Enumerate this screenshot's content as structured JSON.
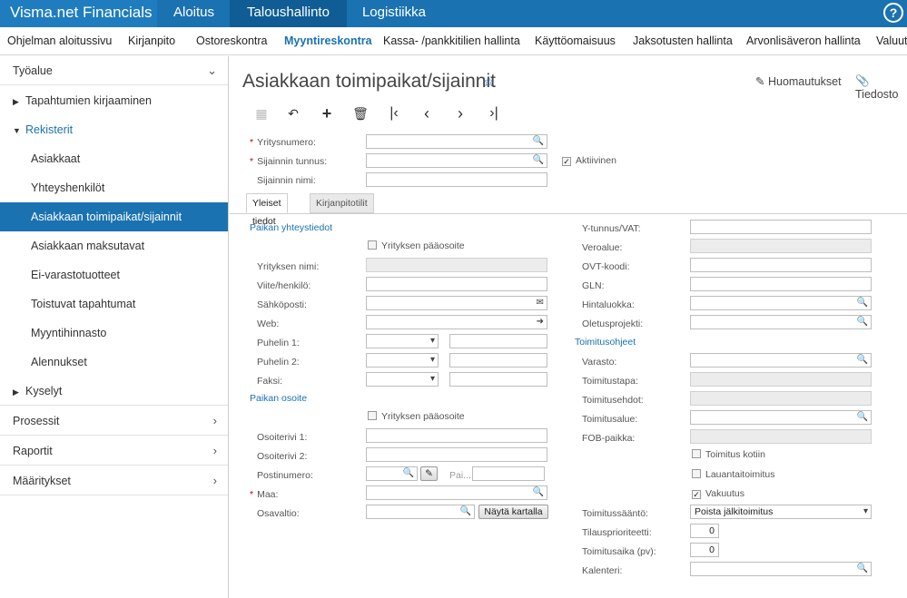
{
  "topbar": {
    "brand": "Visma.net Financials",
    "items": [
      "Aloitus",
      "Taloushallinto",
      "Logistiikka"
    ],
    "help": "?"
  },
  "subnav": {
    "items": [
      "Ohjelman aloitussivu",
      "Kirjanpito",
      "Ostoreskontra",
      "Myyntireskontra",
      "Kassa- /pankkitilien hallinta",
      "Käyttöomaisuus",
      "Jaksotusten hallinta",
      "Arvonlisäveron hallinta",
      "Valuut"
    ]
  },
  "sidebar": {
    "workspace": "Työalue",
    "entries": "Tapahtumien kirjaaminen",
    "registers": "Rekisterit",
    "items": [
      "Asiakkaat",
      "Yhteyshenkilöt",
      "Asiakkaan toimipaikat/sijainnit",
      "Asiakkaan maksutavat",
      "Ei-varastotuotteet",
      "Toistuvat tapahtumat",
      "Myyntihinnasto",
      "Alennukset"
    ],
    "queries": "Kyselyt",
    "sections": [
      "Prosessit",
      "Raportit",
      "Määritykset"
    ]
  },
  "page": {
    "title": "Asiakkaan toimipaikat/sijainnit",
    "notes": "Huomautukset",
    "files": "Tiedosto"
  },
  "header_form": {
    "customer_no": "Yritysnumero:",
    "location_id": "Sijainnin tunnus:",
    "location_name": "Sijainnin nimi:",
    "active": "Aktiivinen"
  },
  "tabs": [
    "Yleiset tiedot",
    "Kirjanpitotilit"
  ],
  "contact": {
    "section": "Paikan yhteystiedot",
    "company_main": "Yrityksen pääosoite",
    "company_name": "Yrityksen nimi:",
    "attention": "Viite/henkilö:",
    "email": "Sähköposti:",
    "web": "Web:",
    "phone1": "Puhelin 1:",
    "phone2": "Puhelin 2:",
    "fax": "Faksi:"
  },
  "address": {
    "section": "Paikan osoite",
    "company_main": "Yrityksen pääosoite",
    "line1": "Osoiterivi 1:",
    "line2": "Osoiterivi 2:",
    "postal": "Postinumero:",
    "city_placeholder": "Pai...",
    "country": "Maa:",
    "state": "Osavaltio:",
    "map_button": "Näytä kartalla"
  },
  "right": {
    "vat": "Y-tunnus/VAT:",
    "tax_zone": "Veroalue:",
    "ovt": "OVT-koodi:",
    "gln": "GLN:",
    "price_class": "Hintaluokka:",
    "default_project": "Oletusprojekti:",
    "shipping_section": "Toimitusohjeet",
    "warehouse": "Varasto:",
    "ship_via": "Toimitustapa:",
    "ship_terms": "Toimitusehdot:",
    "ship_zone": "Toimitusalue:",
    "fob": "FOB-paikka:",
    "residential": "Toimitus kotiin",
    "saturday": "Lauantaitoimitus",
    "insurance": "Vakuutus",
    "ship_rule": "Toimitussääntö:",
    "ship_rule_value": "Poista jälkitoimitus",
    "priority": "Tilausprioriteetti:",
    "priority_value": "0",
    "lead_time": "Toimitusaika (pv):",
    "lead_time_value": "0",
    "calendar": "Kalenteri:"
  }
}
